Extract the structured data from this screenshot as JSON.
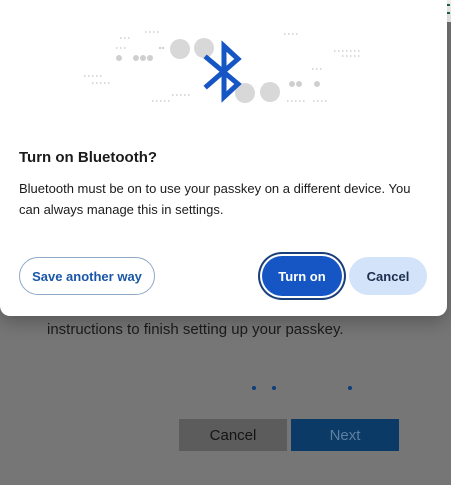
{
  "background_window": {
    "instructions": "instructions to finish setting up your passkey.",
    "cancel_label": "Cancel",
    "next_label": "Next"
  },
  "dialog": {
    "icon": "bluetooth-icon",
    "title": "Turn on Bluetooth?",
    "body": "Bluetooth must be on to use your passkey on a different device. You can always manage this in settings.",
    "save_another_way_label": "Save another way",
    "turn_on_label": "Turn on",
    "cancel_label": "Cancel"
  },
  "colors": {
    "accent": "#1656c4",
    "bluetooth_icon": "#1656c4",
    "secondary_button_bg": "#d3e3f9"
  }
}
